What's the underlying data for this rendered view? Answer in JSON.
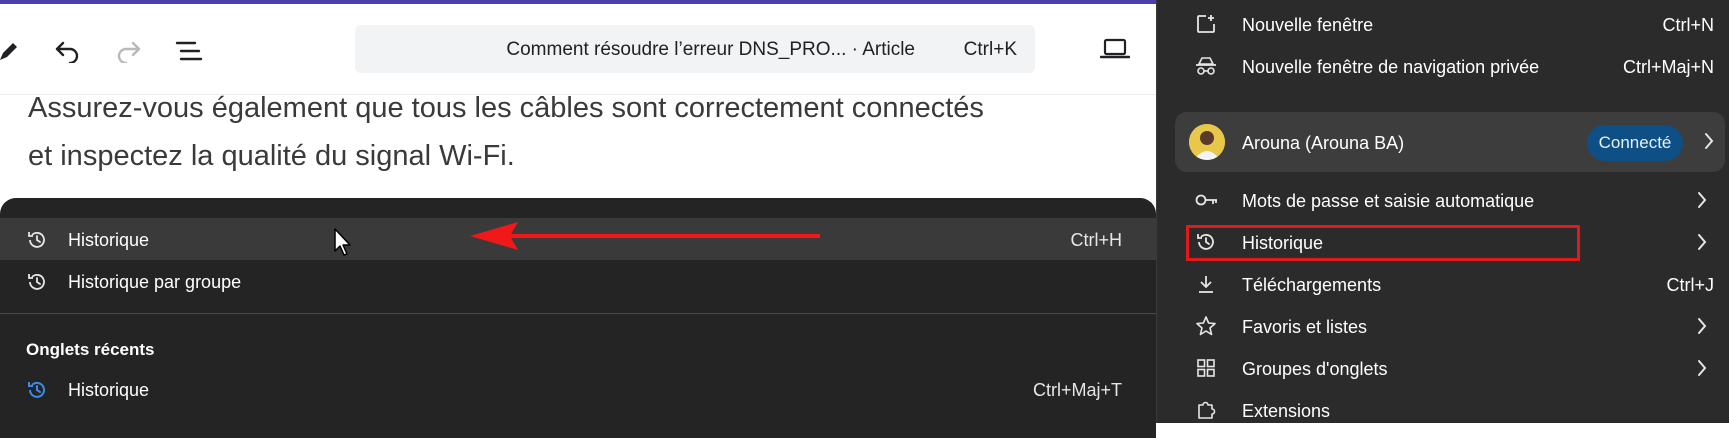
{
  "toolbar": {
    "omnibox_title": "Comment résoudre l’erreur DNS_PRO...  · Article",
    "omnibox_shortcut": "Ctrl+K"
  },
  "article": {
    "line1": "Assurez-vous également que tous les câbles sont correctement connectés",
    "line2": "et inspectez la qualité du signal Wi-Fi."
  },
  "history_menu": {
    "items": [
      {
        "label": "Historique",
        "shortcut": "Ctrl+H",
        "icon": "history-icon"
      },
      {
        "label": "Historique par groupe",
        "shortcut": "",
        "icon": "history-icon"
      }
    ],
    "section_title": "Onglets récents",
    "recent": [
      {
        "label": "Historique",
        "shortcut": "Ctrl+Maj+T",
        "icon": "history-blue-icon"
      }
    ]
  },
  "browser_menu": {
    "items_top": [
      {
        "label": "Nouvelle fenêtre",
        "shortcut": "Ctrl+N",
        "icon": "new-window-icon"
      },
      {
        "label": "Nouvelle fenêtre de navigation privée",
        "shortcut": "Ctrl+Maj+N",
        "icon": "incognito-icon"
      }
    ],
    "profile": {
      "name": "Arouna (Arouna BA)",
      "status": "Connecté"
    },
    "items": [
      {
        "label": "Mots de passe et saisie automatique",
        "shortcut": "",
        "icon": "key-icon"
      },
      {
        "label": "Historique",
        "shortcut": "",
        "icon": "history-icon"
      },
      {
        "label": "Téléchargements",
        "shortcut": "Ctrl+J",
        "icon": "download-icon"
      },
      {
        "label": "Favoris et listes",
        "shortcut": "",
        "icon": "star-icon"
      },
      {
        "label": "Groupes d'onglets",
        "shortcut": "",
        "icon": "tab-groups-icon"
      },
      {
        "label": "Extensions",
        "shortcut": "",
        "icon": "puzzle-icon"
      }
    ]
  },
  "colors": {
    "accent_bar": "#4b3fae",
    "menu_bg": "#2b2b2b",
    "dropdown_bg": "#242424",
    "highlight_red": "#e01a1a",
    "connected_badge": "#0e4f86"
  }
}
